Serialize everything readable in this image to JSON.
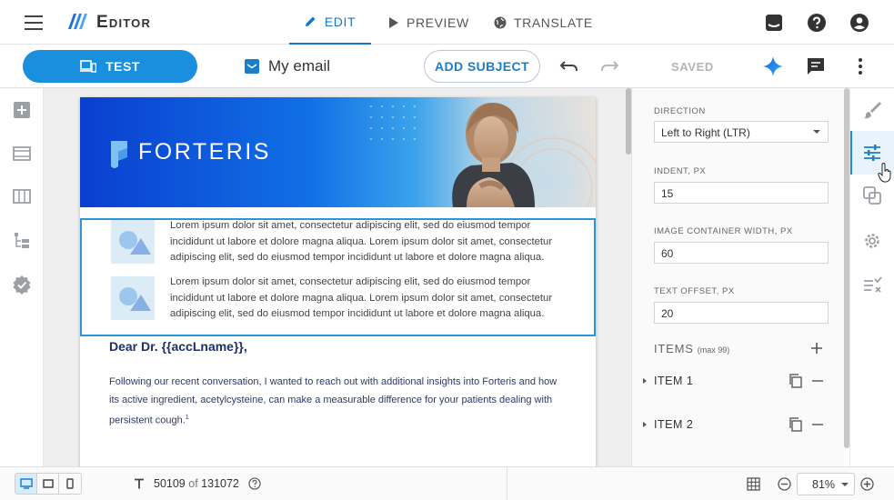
{
  "app": {
    "title": "Editor"
  },
  "header": {
    "tabs": [
      {
        "label": "EDIT",
        "icon": "pencil-icon",
        "active": true
      },
      {
        "label": "PREVIEW",
        "icon": "play-icon",
        "active": false
      },
      {
        "label": "TRANSLATE",
        "icon": "globe-icon",
        "active": false
      }
    ],
    "icons": [
      "inbox-icon",
      "help-icon",
      "account-icon"
    ]
  },
  "toolbar": {
    "test_label": "TEST",
    "email_name": "My email",
    "add_subject_label": "ADD SUBJECT",
    "saved_label": "SAVED",
    "accent_color": "#1a8fde"
  },
  "email": {
    "brand_name": "FORTERIS",
    "items": [
      {
        "text": "Lorem ipsum dolor sit amet, consectetur adipiscing elit, sed do eiusmod tempor incididunt ut labore et dolore magna aliqua. Lorem ipsum dolor sit amet, consectetur adipiscing elit, sed do eiusmod tempor incididunt ut labore et dolore magna aliqua."
      },
      {
        "text": "Lorem ipsum dolor sit amet, consectetur adipiscing elit, sed do eiusmod tempor incididunt ut labore et dolore magna aliqua. Lorem ipsum dolor sit amet, consectetur adipiscing elit, sed do eiusmod tempor incididunt ut labore et dolore magna aliqua."
      }
    ],
    "greeting": "Dear Dr. {{accLname}},",
    "body": "Following our recent conversation, I wanted to reach out with additional insights into Forteris and how its active ingredient, acetylcysteine, can make a measurable difference for your patients dealing with persistent cough.",
    "footnote": "1"
  },
  "panel": {
    "direction": {
      "label": "DIRECTION",
      "value": "Left to Right (LTR)"
    },
    "indent": {
      "label": "INDENT, PX",
      "value": "15"
    },
    "image_container_width": {
      "label": "IMAGE CONTAINER WIDTH, PX",
      "value": "60"
    },
    "text_offset": {
      "label": "TEXT OFFSET, PX",
      "value": "20"
    },
    "items_title": "ITEMS",
    "items_max": "(max 99)",
    "items": [
      {
        "label": "ITEM 1"
      },
      {
        "label": "ITEM 2"
      }
    ]
  },
  "status": {
    "char_count": "50109",
    "of_label": "of",
    "char_limit": "131072",
    "zoom": "81%"
  }
}
